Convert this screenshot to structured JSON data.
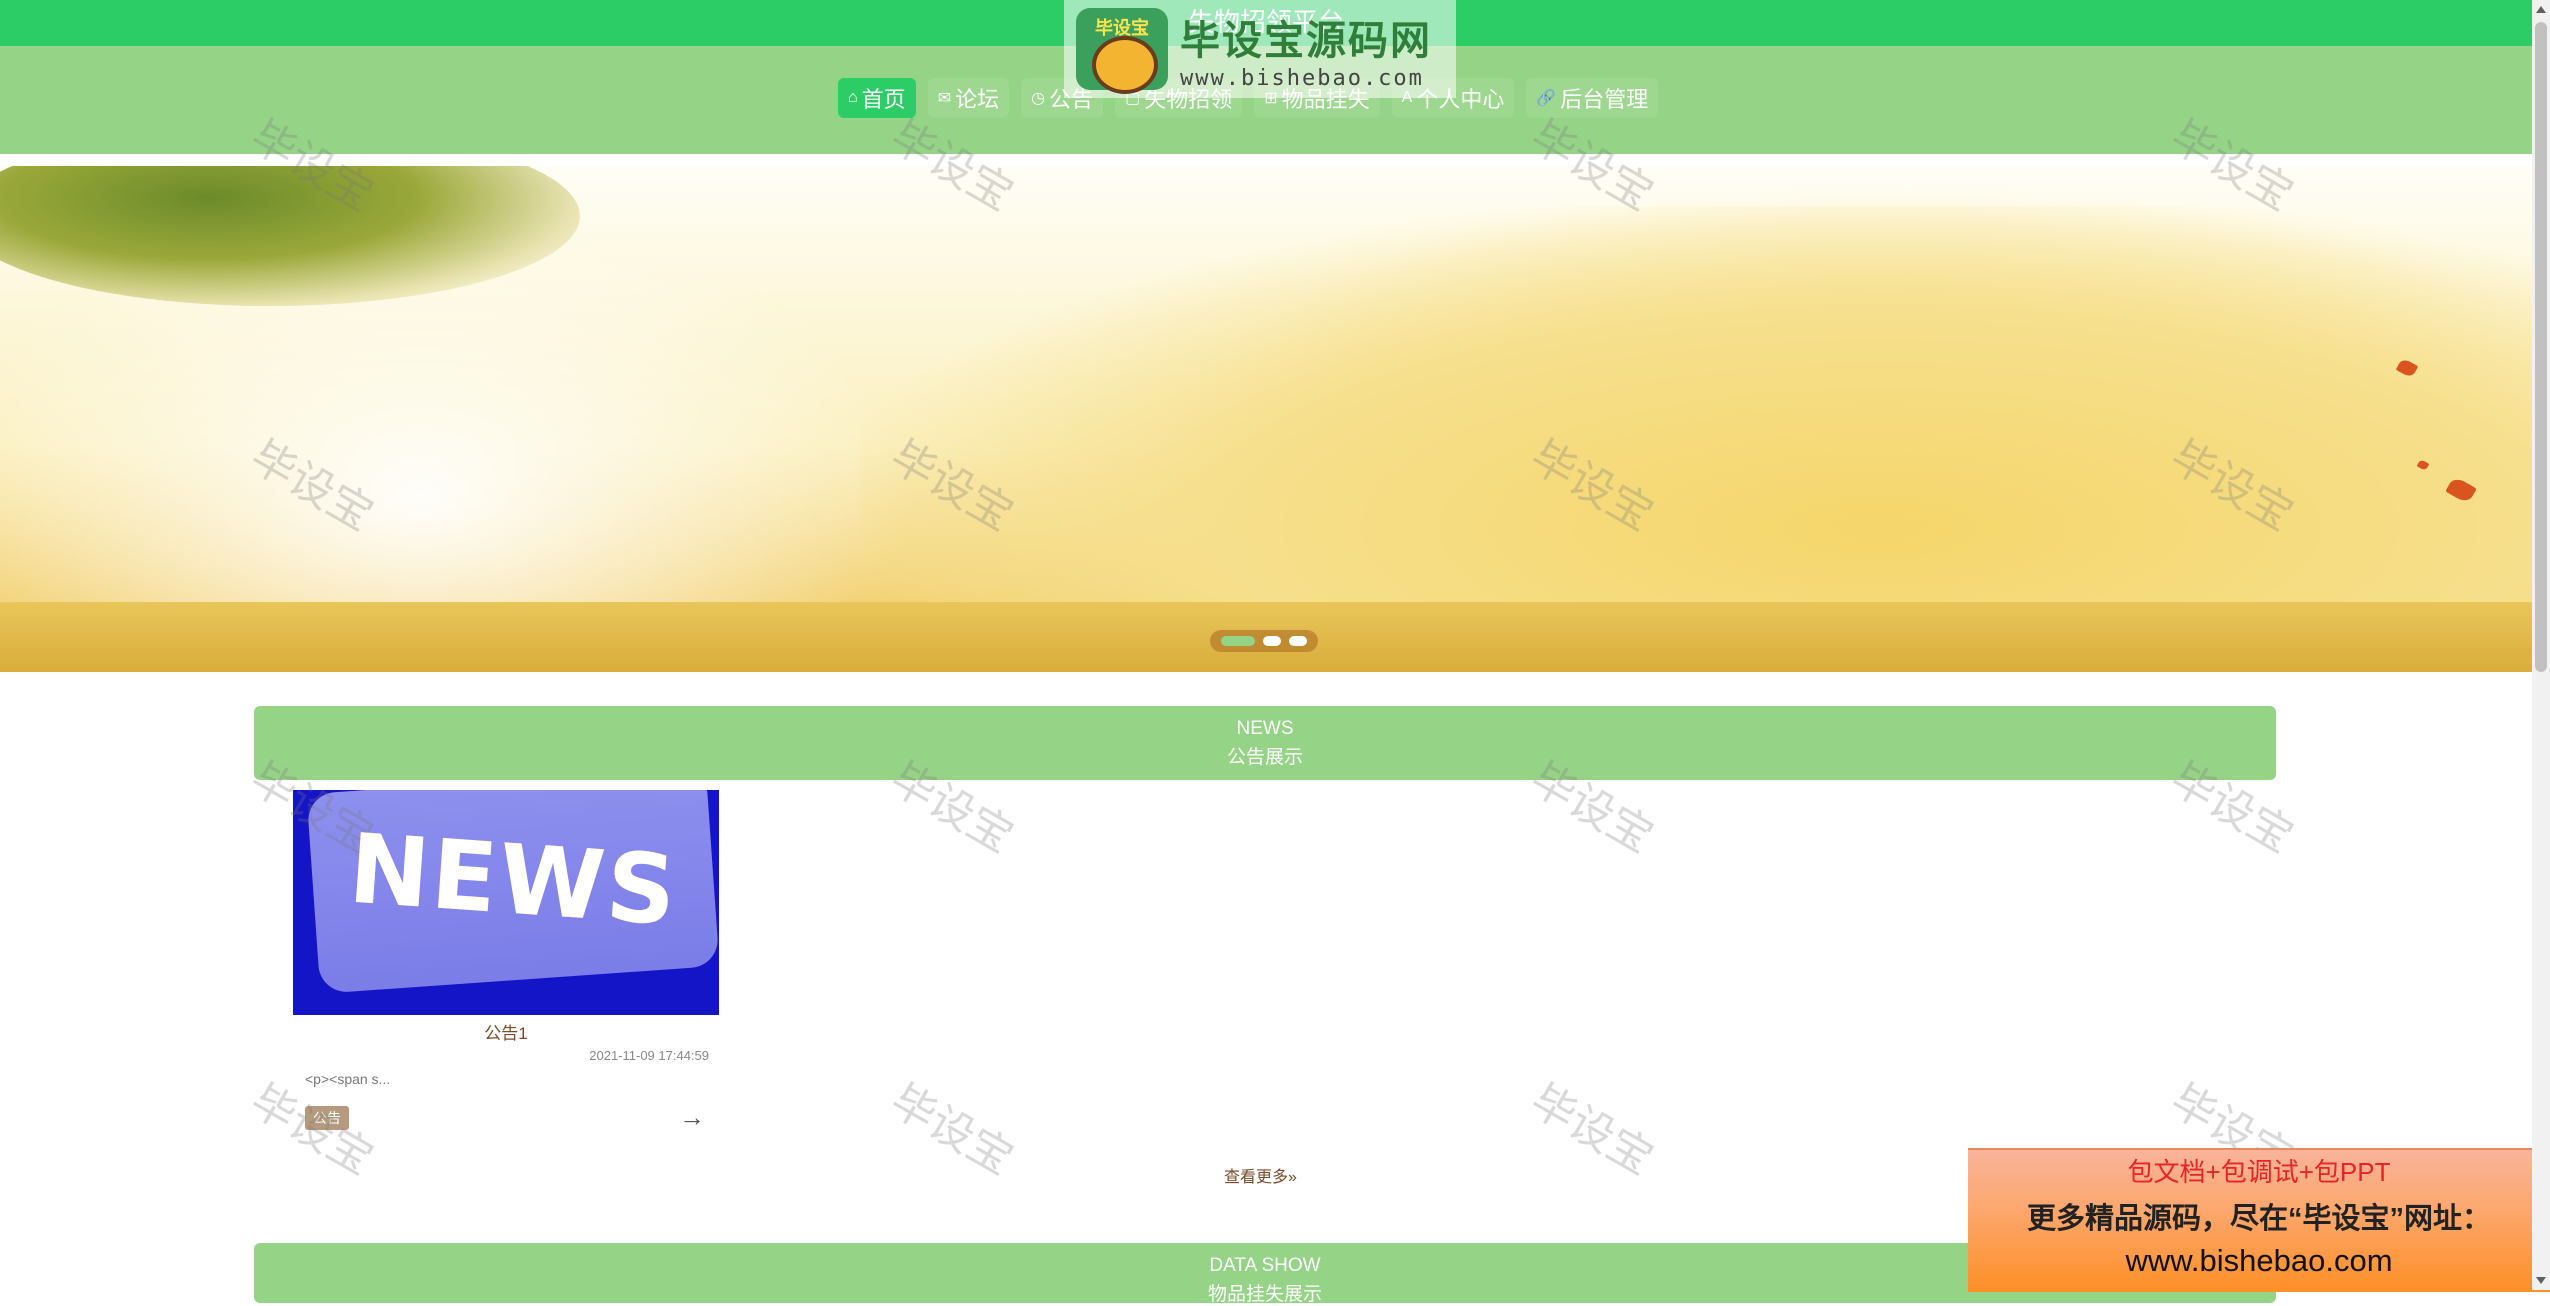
{
  "site": {
    "title": "失物招领平台"
  },
  "nav": {
    "items": [
      {
        "label": "首页",
        "icon": "home-icon",
        "glyph": "⌂",
        "active": true
      },
      {
        "label": "论坛",
        "icon": "mail-icon",
        "glyph": "✉",
        "active": false
      },
      {
        "label": "公告",
        "icon": "clock-icon",
        "glyph": "◷",
        "active": false
      },
      {
        "label": "失物招领",
        "icon": "document-icon",
        "glyph": "▢",
        "active": false
      },
      {
        "label": "物品挂失",
        "icon": "grid-icon",
        "glyph": "⊞",
        "active": false
      },
      {
        "label": "个人中心",
        "icon": "user-icon",
        "glyph": "A",
        "active": false
      },
      {
        "label": "后台管理",
        "icon": "link-icon",
        "glyph": "🔗",
        "active": false
      }
    ]
  },
  "watermark": {
    "badge_text": "毕设宝",
    "brand": "毕设宝源码网",
    "url": "www.bishebao.com",
    "tile_text": "毕设宝"
  },
  "carousel": {
    "slide_count": 3,
    "active_index": 0
  },
  "news_section": {
    "title_en": "NEWS",
    "title_cn": "公告展示",
    "image_text": "NEWS",
    "items": [
      {
        "title": "公告1",
        "date": "2021-11-09 17:44:59",
        "excerpt": "<p><span s...",
        "tag": "公告",
        "arrow": "→"
      }
    ],
    "more_label": "查看更多»"
  },
  "data_section": {
    "title_en": "DATA SHOW",
    "title_cn": "物品挂失展示"
  },
  "ad": {
    "line1": "包文档+包调试+包PPT",
    "line2": "更多精品源码，尽在“毕设宝”网址：",
    "line3": "www.bishebao.com"
  },
  "colors": {
    "primary_green": "#2ccd66",
    "nav_band": "#95d487",
    "accent_brown": "#7a4a2a"
  }
}
